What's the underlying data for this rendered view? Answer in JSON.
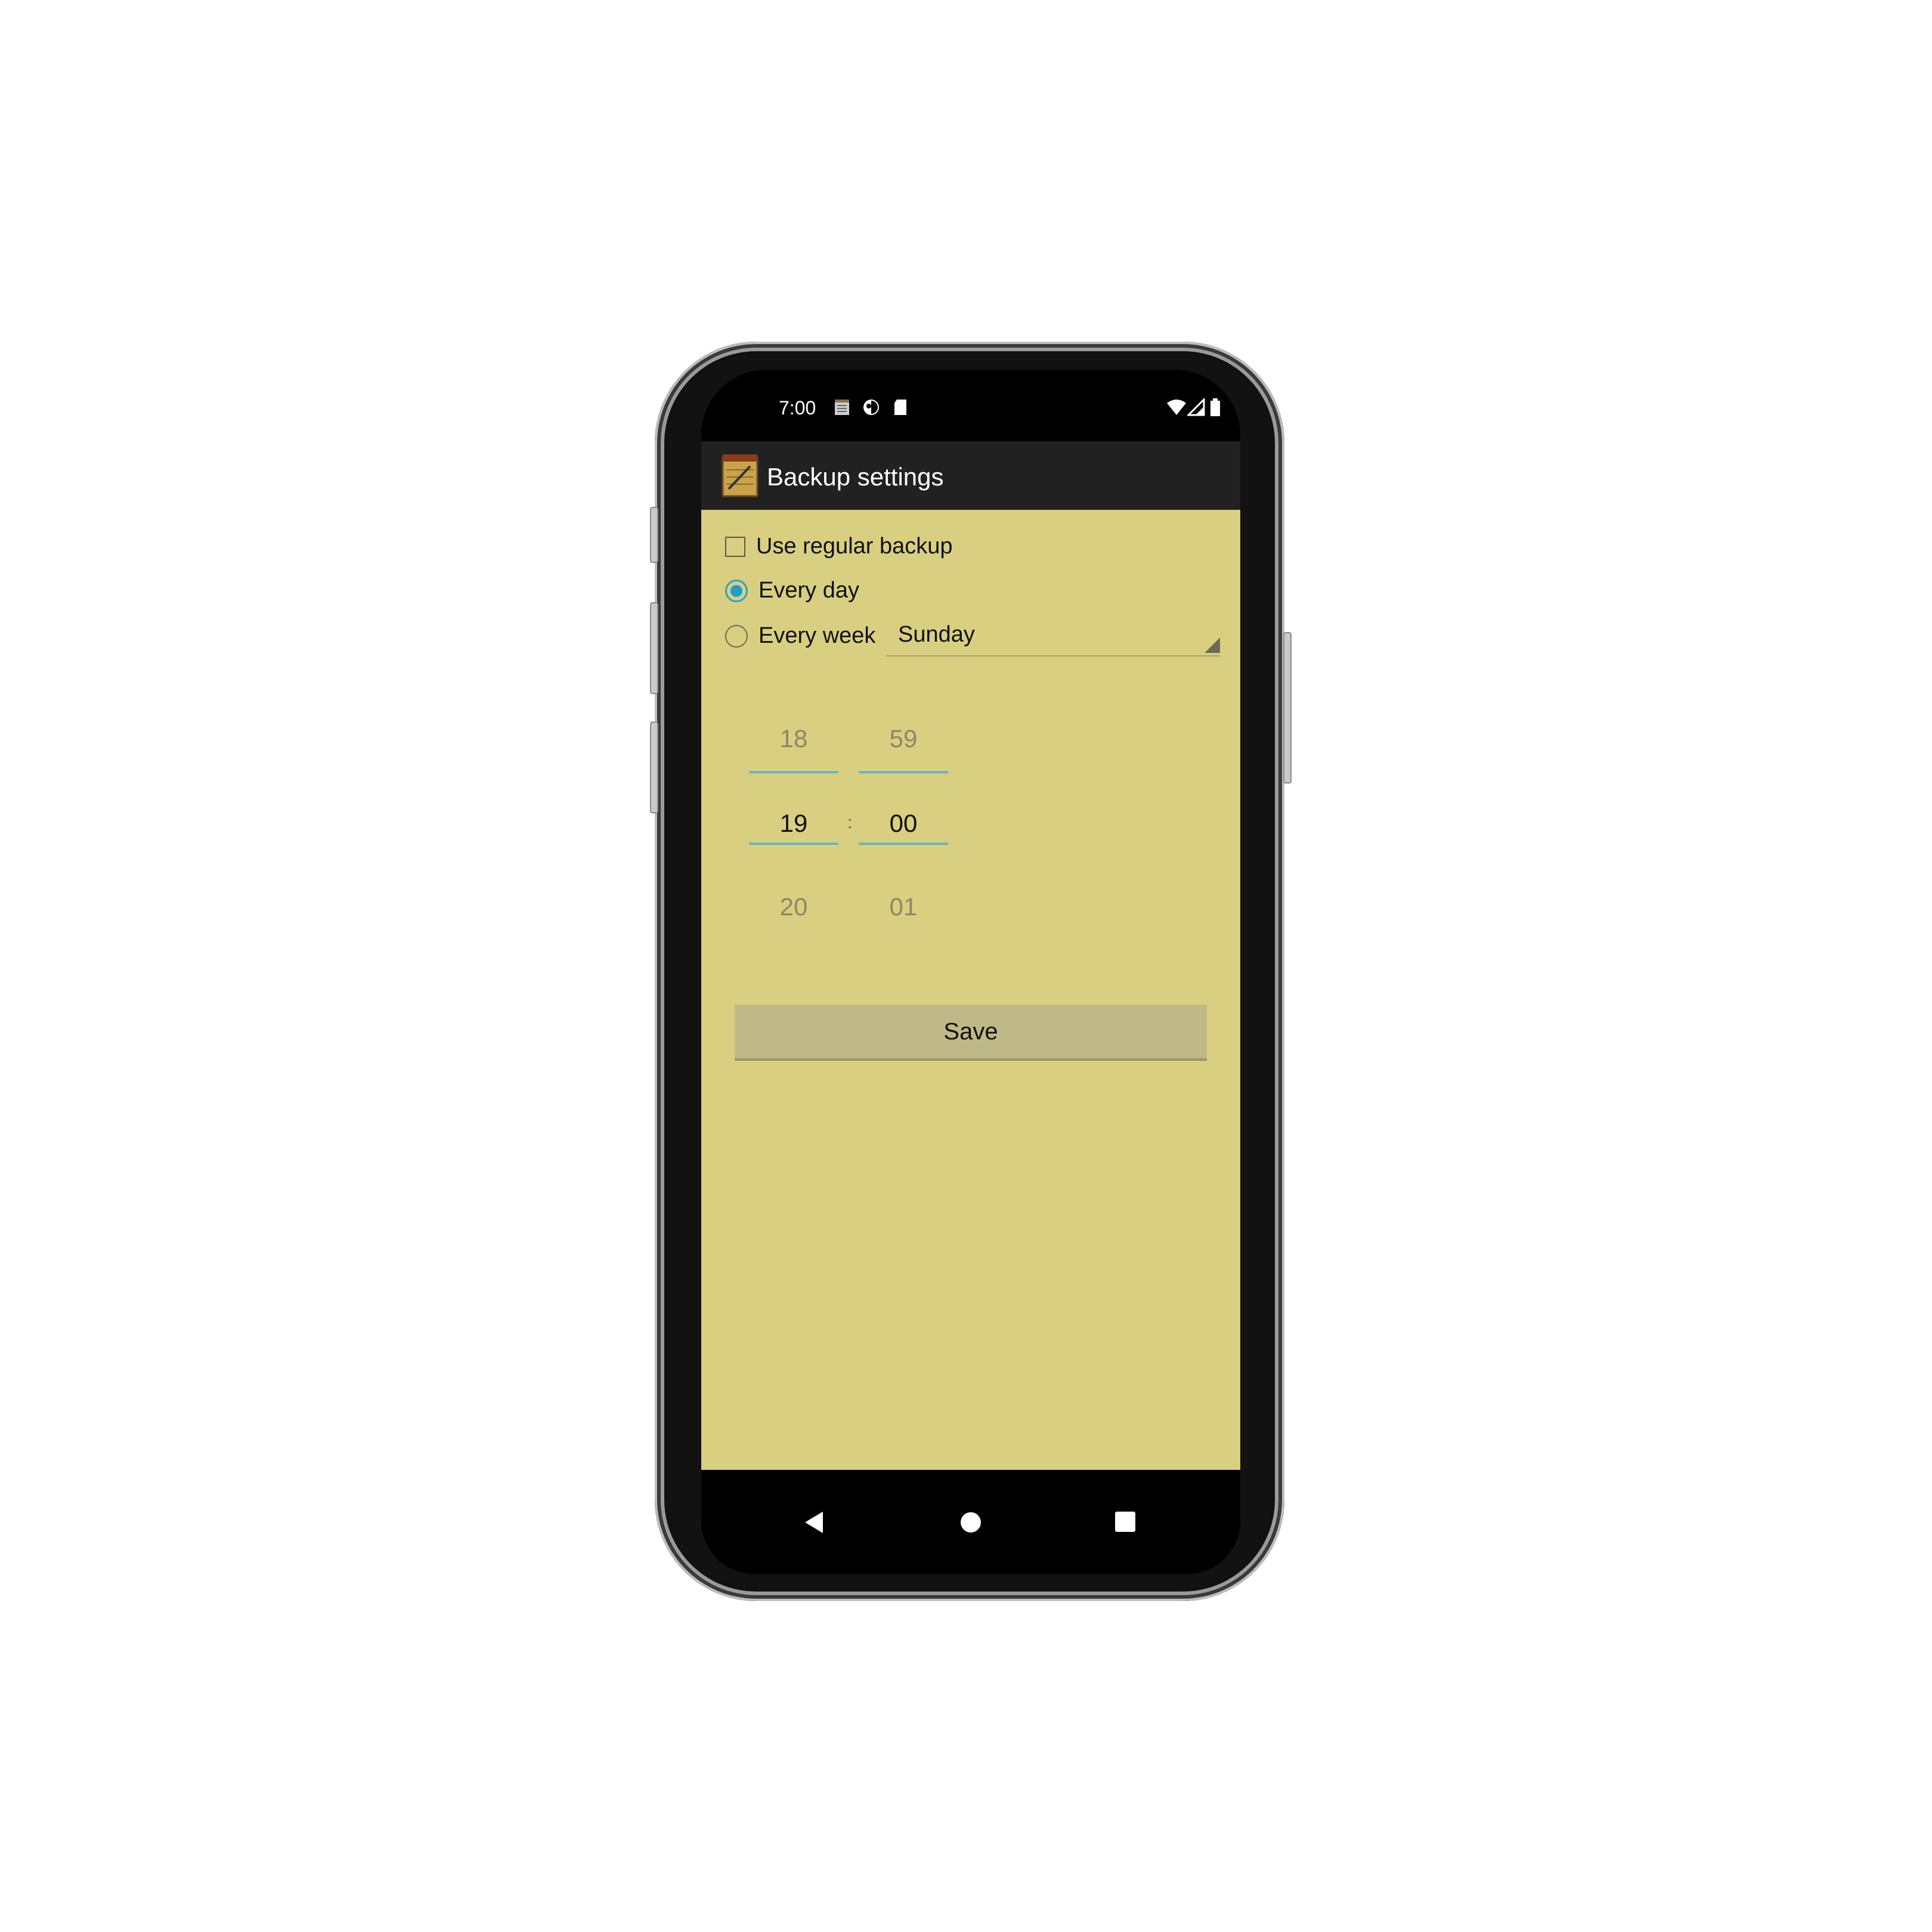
{
  "status_bar": {
    "time": "7:00",
    "left_icons": [
      "notes-icon",
      "media-icon",
      "sd-card-icon"
    ],
    "right_icons": [
      "wifi-icon",
      "signal-icon",
      "battery-icon"
    ]
  },
  "app_bar": {
    "icon": "notebook-app-icon",
    "title": "Backup settings"
  },
  "settings": {
    "use_regular_backup_label": "Use regular backup",
    "every_day_label": "Every day",
    "every_week_label": "Every week",
    "weekday_selected": "Sunday",
    "every_day_selected": true
  },
  "time_picker": {
    "hours": {
      "prev": "18",
      "current": "19",
      "next": "20"
    },
    "minutes": {
      "prev": "59",
      "current": "00",
      "next": "01"
    },
    "separator": ":"
  },
  "save_label": "Save",
  "nav_bar": [
    "back-icon",
    "home-icon",
    "recents-icon"
  ],
  "colors": {
    "content_bg": "#d9cf80",
    "app_bar_bg": "#212121",
    "accent": "#1a9fd0",
    "save_bg": "#bfb987"
  }
}
